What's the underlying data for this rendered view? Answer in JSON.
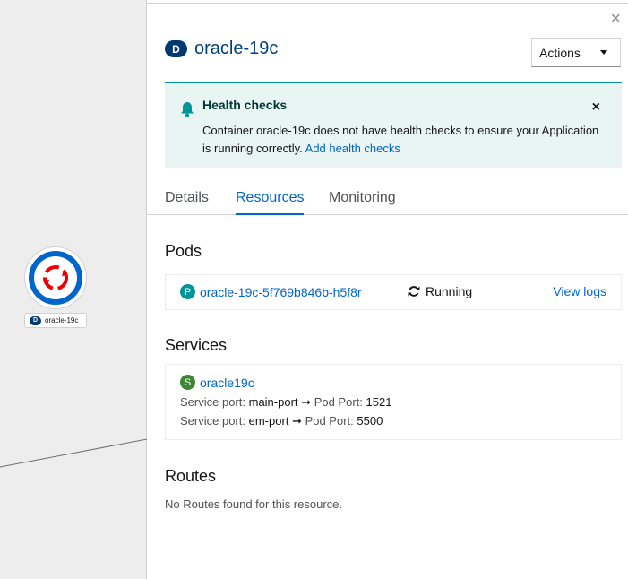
{
  "topology": {
    "node_label": "oracle-19c",
    "node_badge": "D"
  },
  "panel": {
    "close_icon": "×",
    "badge": "D",
    "title": "oracle-19c",
    "actions_label": "Actions",
    "colors": {
      "accent": "#0066cc",
      "badge_dark": "#003a70",
      "pod_badge": "#009596",
      "service_badge": "#3e8635"
    }
  },
  "alert": {
    "title": "Health checks",
    "body": "Container oracle-19c does not have health checks to ensure your Application is running correctly.",
    "link": "Add health checks",
    "close": "×"
  },
  "tabs": [
    {
      "label": "Details"
    },
    {
      "label": "Resources"
    },
    {
      "label": "Monitoring"
    }
  ],
  "pods": {
    "title": "Pods",
    "badge": "P",
    "name": "oracle-19c-5f769b846b-h5f8r",
    "status": "Running",
    "view_logs": "View logs"
  },
  "services": {
    "title": "Services",
    "badge": "S",
    "name": "oracle19c",
    "ports": [
      {
        "label": "Service port:",
        "port": "main-port",
        "pod_label": "Pod Port:",
        "pod_port": "1521"
      },
      {
        "label": "Service port:",
        "port": "em-port",
        "pod_label": "Pod Port:",
        "pod_port": "5500"
      }
    ]
  },
  "routes": {
    "title": "Routes",
    "empty": "No Routes found for this resource."
  }
}
